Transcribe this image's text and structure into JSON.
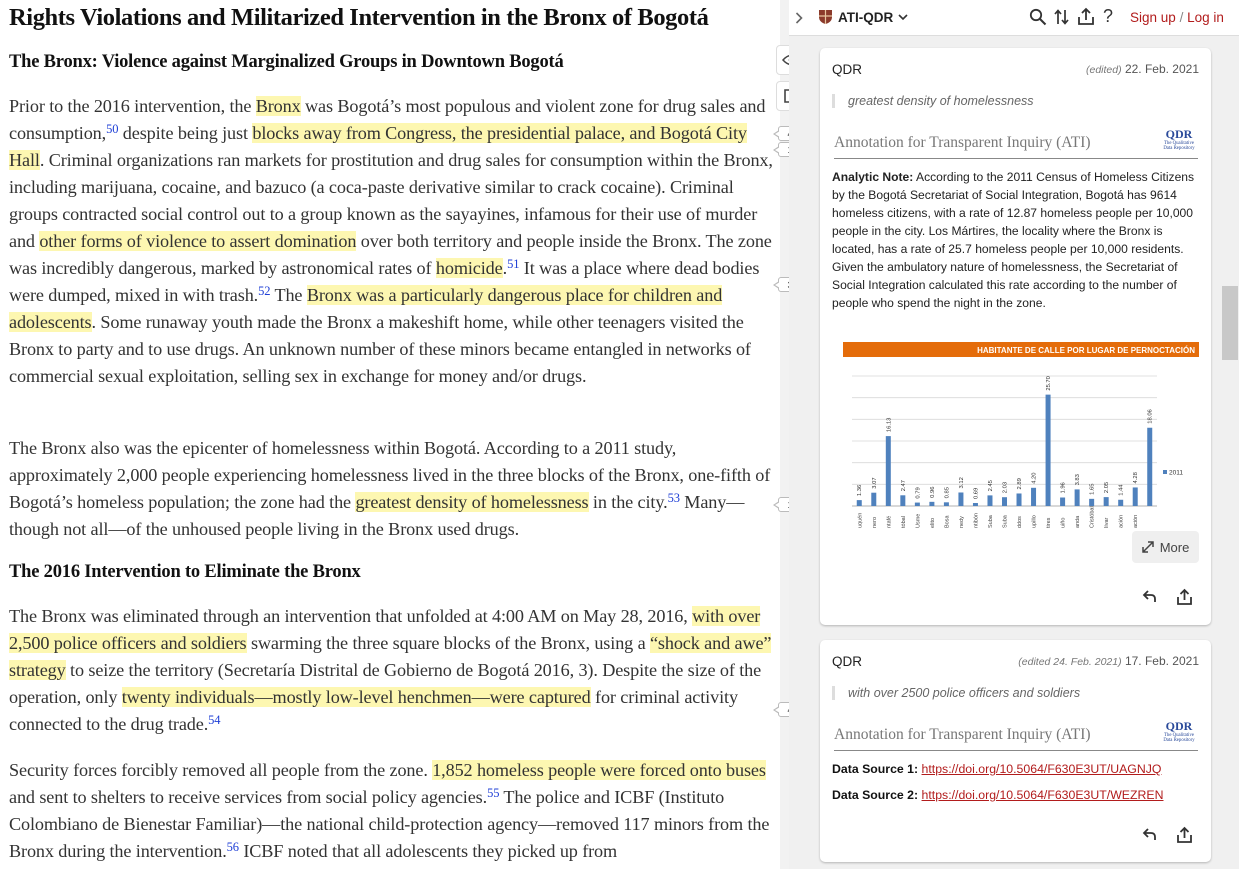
{
  "article": {
    "title": "Rights Violations and Militarized Intervention in the Bronx of Bogotá",
    "section1_heading": "The Bronx: Violence against Marginalized Groups in Downtown Bogotá",
    "p1": [
      {
        "t": "Prior to the 2016 intervention, the "
      },
      {
        "t": "Bronx",
        "hl": true
      },
      {
        "t": " was Bogotá’s most populous and violent zone for drug sales and consumption,"
      },
      {
        "t": "50",
        "fn": true
      },
      {
        "t": " despite being just "
      },
      {
        "t": "blocks away from Congress, the presidential palace, and Bogotá City Hall",
        "hl": true
      },
      {
        "t": ". Criminal organizations ran markets for prostitution and drug sales for consumption within the Bronx, including marijuana, cocaine, and bazuco (a coca-paste derivative similar to crack cocaine). Criminal groups contracted social control out to a group known as the sayayines, infamous for their use of murder and "
      },
      {
        "t": "other forms of violence to assert domination",
        "hl": true
      },
      {
        "t": " over both territory and people inside the Bronx. The zone was incredibly dangerous, marked by astronomical rates of "
      },
      {
        "t": "homicide",
        "hl": true
      },
      {
        "t": "."
      },
      {
        "t": "51",
        "fn": true
      },
      {
        "t": " It was a place where dead bodies were dumped, mixed in with trash."
      },
      {
        "t": "52",
        "fn": true
      },
      {
        "t": " The "
      },
      {
        "t": "Bronx was a particularly dangerous place for children and adolescents",
        "hl": true
      },
      {
        "t": ". Some runaway youth made the Bronx a makeshift home, while other teenagers visited the Bronx to party and to use drugs. An unknown number of these minors became entangled in networks of commercial sexual exploitation, selling sex in exchange for money and/or drugs."
      }
    ],
    "p2": [
      {
        "t": "The Bronx also was the epicenter of homelessness within Bogotá. According to a 2011 study, approximately 2,000 people experiencing homelessness lived in the three blocks of the Bronx, one-fifth of Bogotá’s homeless population; the zone had the "
      },
      {
        "t": "greatest density of homelessness",
        "hl": true
      },
      {
        "t": " in the city."
      },
      {
        "t": "53",
        "fn": true
      },
      {
        "t": " Many—though not all—of the unhoused people living in the Bronx used drugs."
      }
    ],
    "section2_heading": "The 2016 Intervention to Eliminate the Bronx",
    "p3": [
      {
        "t": "The Bronx was eliminated through an intervention that unfolded at 4:00 AM on May 28, 2016, "
      },
      {
        "t": "with over 2,500 police officers and soldiers",
        "hl": true
      },
      {
        "t": " swarming the three square blocks of the Bronx, using a "
      },
      {
        "t": "“shock and awe” strategy",
        "hl": true
      },
      {
        "t": " to seize the territory (Secretaría Distrital de Gobierno de Bogotá 2016, 3). Despite the size of the operation, only "
      },
      {
        "t": "twenty individuals—mostly low-level henchmen—were captured",
        "hl": true
      },
      {
        "t": " for criminal activity connected to the drug trade."
      },
      {
        "t": "54",
        "fn": true
      }
    ],
    "p4": [
      {
        "t": "Security forces forcibly removed all people from the zone. "
      },
      {
        "t": "1,852 homeless people were forced onto buses",
        "hl": true
      },
      {
        "t": " and sent to shelters to receive services from social policy agencies."
      },
      {
        "t": "55",
        "fn": true
      },
      {
        "t": " The police and ICBF (Instituto Colombiano de Bienestar Familiar)—the national child-protection agency—removed 117 minors from the Bronx during the intervention."
      },
      {
        "t": "56",
        "fn": true
      },
      {
        "t": " ICBF noted that all adolescents they picked up from"
      }
    ]
  },
  "gutter": {
    "badges": [
      "4",
      "1",
      "3",
      "1",
      "4"
    ]
  },
  "sidebar": {
    "group_name": "ATI-QDR",
    "sign_up": "Sign up",
    "separator": "/",
    "log_in": "Log in",
    "icons": [
      "chevron-right-icon",
      "shield-icon",
      "search-icon",
      "sort-icon",
      "share-icon",
      "help-icon"
    ],
    "cards": [
      {
        "user": "QDR",
        "edited": "(edited)",
        "date": "22. Feb. 2021",
        "quote": "greatest density of homelessness",
        "ati_text": "Annotation for Transparent Inquiry (ATI)",
        "logo_big": "QDR",
        "logo_small1": "The Qualitative",
        "logo_small2": "Data Repository",
        "note_label": "Analytic Note:",
        "note_text": " According to the 2011 Census of Homeless Citizens by the Bogotá Secretariat of Social Integration, Bogotá has 9614 homeless citizens, with a rate of 12.87 homeless people per 10,000 people in the city. Los Mártires, the locality where the Bronx is located, has a rate of 25.7 homeless people per 10,000 residents. Given the ambulatory nature of homelessness, the Secretariat of Social Integration calculated this rate according to the number of people who spend the night in the zone.",
        "more": "More"
      },
      {
        "user": "QDR",
        "edited": "(edited 24. Feb. 2021)",
        "date": "17. Feb. 2021",
        "quote": "with over 2500 police officers and soldiers",
        "ati_text": "Annotation for Transparent Inquiry (ATI)",
        "logo_big": "QDR",
        "logo_small1": "The Qualitative",
        "logo_small2": "Data Repository",
        "ds1_label": "Data Source 1:",
        "ds1_url": "https://doi.org/10.5064/F630E3UT/UAGNJQ",
        "ds2_label": "Data Source 2:",
        "ds2_url": "https://doi.org/10.5064/F630E3UT/WEZREN"
      }
    ]
  },
  "chart_data": {
    "type": "bar",
    "title": "HABITANTE DE CALLE POR LUGAR DE PERNOCTACIÓN",
    "categories": [
      "uquén",
      "nero",
      "ntafé",
      "tóbal",
      "Usme",
      "elito",
      "Bosa",
      "nedy",
      "ntibón",
      "Suba",
      "Suba",
      "ddos",
      "upillo",
      "tires",
      "uiño",
      "anda",
      "Cristóbal",
      "lívar",
      "ación",
      "ación"
    ],
    "series": [
      {
        "name": "2011",
        "values": [
          1.36,
          3.07,
          16.13,
          2.47,
          0.79,
          0.96,
          0.85,
          3.12,
          0.69,
          2.45,
          2.03,
          2.89,
          4.2,
          25.7,
          1.96,
          3.83,
          1.65,
          2.05,
          1.44,
          4.28,
          18.06
        ]
      }
    ],
    "value_labels": [
      "1.36",
      "3.07",
      "16.13",
      "2.47",
      "0.79",
      "0.96",
      "0.85",
      "3.12",
      "0.69",
      "2.45",
      "2.03",
      "2.89",
      "4.20",
      "25.70",
      "1.96",
      "3.83",
      "1.65",
      "2.05",
      "1.44",
      "4.28",
      "18.06"
    ],
    "ylim": [
      0,
      30
    ],
    "legend": "right",
    "colors": {
      "bar": "#4f81bd",
      "title_bg": "#e46c0a"
    }
  }
}
